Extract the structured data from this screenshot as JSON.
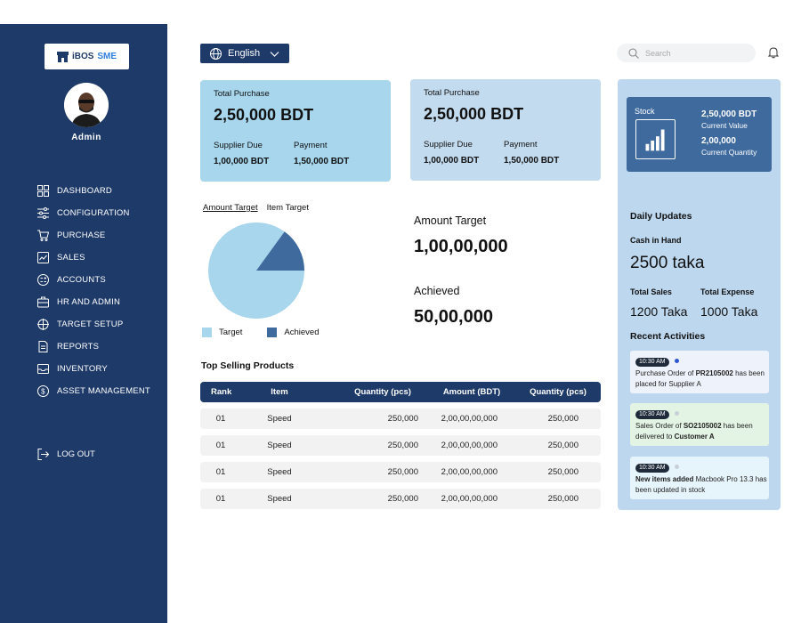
{
  "app": {
    "brand_prefix": "iBOS",
    "brand_suffix": "SME",
    "user_role": "Admin"
  },
  "sidebar": {
    "items": [
      {
        "label": "DASHBOARD",
        "icon": "grid-icon"
      },
      {
        "label": "CONFIGURATION",
        "icon": "sliders-icon"
      },
      {
        "label": "PURCHASE",
        "icon": "cart-icon"
      },
      {
        "label": "SALES",
        "icon": "trend-chart-icon"
      },
      {
        "label": "ACCOUNTS",
        "icon": "calculator-icon"
      },
      {
        "label": "HR AND ADMIN",
        "icon": "briefcase-icon"
      },
      {
        "label": "TARGET SETUP",
        "icon": "crosshair-icon"
      },
      {
        "label": "REPORTS",
        "icon": "document-icon"
      },
      {
        "label": "INVENTORY",
        "icon": "inbox-icon"
      },
      {
        "label": "ASSET MANAGEMENT",
        "icon": "dollar-coin-icon"
      }
    ],
    "logout": "LOG OUT"
  },
  "topbar": {
    "language": "English",
    "search_placeholder": "Search"
  },
  "cards": [
    {
      "title": "Total Purchase",
      "amount": "2,50,000 BDT",
      "due_label": "Supplier Due",
      "due_value": "1,00,000 BDT",
      "pay_label": "Payment",
      "pay_value": "1,50,000 BDT"
    },
    {
      "title": "Total Purchase",
      "amount": "2,50,000 BDT",
      "due_label": "Supplier Due",
      "due_value": "1,00,000 BDT",
      "pay_label": "Payment",
      "pay_value": "1,50,000 BDT"
    }
  ],
  "target": {
    "tabs": [
      "Amount Target",
      "Item Target"
    ],
    "legend_target": "Target",
    "legend_achieved": "Achieved",
    "amount_target_label": "Amount Target",
    "amount_target_value": "1,00,00,000",
    "achieved_label": "Achieved",
    "achieved_value": "50,00,000",
    "pie_achieved_fraction": 0.15,
    "colors": {
      "target": "#a7d6ed",
      "achieved": "#3e6a9e"
    }
  },
  "table": {
    "title": "Top Selling Products",
    "headers": [
      "Rank",
      "Item",
      "Quantity (pcs)",
      "Amount (BDT)",
      "Quantity (pcs)"
    ],
    "rows": [
      [
        "01",
        "Speed",
        "250,000",
        "2,00,00,00,000",
        "250,000"
      ],
      [
        "01",
        "Speed",
        "250,000",
        "2,00,00,00,000",
        "250,000"
      ],
      [
        "01",
        "Speed",
        "250,000",
        "2,00,00,00,000",
        "250,000"
      ],
      [
        "01",
        "Speed",
        "250,000",
        "2,00,00,00,000",
        "250,000"
      ]
    ]
  },
  "panel": {
    "stock": {
      "label": "Stock",
      "value1": "2,50,000 BDT",
      "label1": "Current Value",
      "value2": "2,00,000",
      "label2": "Current Quantity"
    },
    "daily_updates": "Daily Updates",
    "cash_label": "Cash in Hand",
    "cash_value": "2500 taka",
    "sales_label": "Total Sales",
    "sales_value": "1200 Taka",
    "expense_label": "Total Expense",
    "expense_value": "1000 Taka",
    "recent_title": "Recent  Activities",
    "activities": [
      {
        "time": "10:30 AM",
        "pre": "Purchase Order of ",
        "bold": "PR2105002",
        "post": " has been placed for Supplier A",
        "bg": "#eef2fb",
        "dot": "#2f55d4"
      },
      {
        "time": "10:30 AM",
        "pre": "Sales Order of ",
        "bold": "SO2105002",
        "post": " has been delivered to ",
        "bold2": "Customer A",
        "bg": "#e3f3e4",
        "dot": "#c8cfd6"
      },
      {
        "time": "10:30 AM",
        "pre": "",
        "bold": "New items added",
        "post": " Macbook Pro 13.3 has been updated in stock",
        "bg": "#e6f4fb",
        "dot": "#c8cfd6"
      }
    ]
  }
}
